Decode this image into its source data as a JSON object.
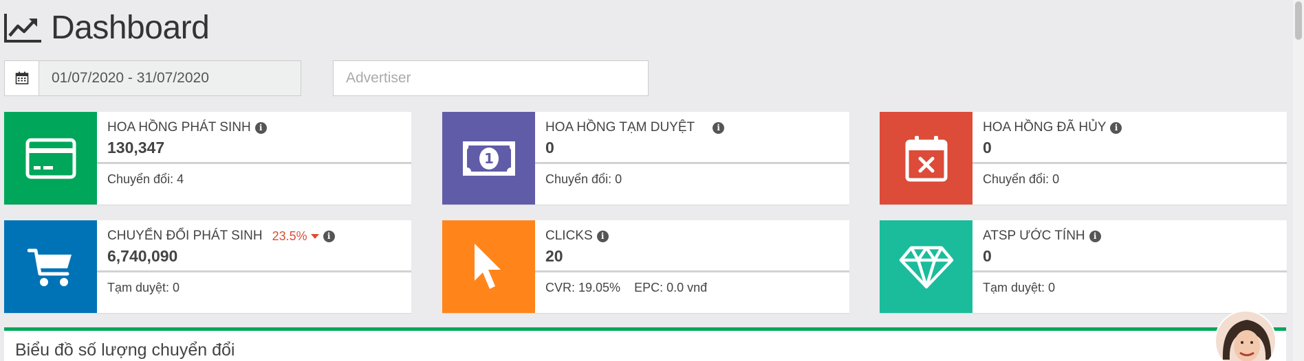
{
  "header": {
    "title": "Dashboard",
    "icon": "line-chart-icon"
  },
  "filters": {
    "date_range": "01/07/2020 - 31/07/2020",
    "advertiser_placeholder": "Advertiser"
  },
  "cards": [
    {
      "label": "HOA HỒNG PHÁT SINH",
      "value": "130,347",
      "footer": "Chuyển đổi: 4",
      "color": "#00a65a",
      "icon": "credit-card-icon"
    },
    {
      "label": "HOA HỒNG TẠM DUYỆT",
      "value": "0",
      "footer": "Chuyển đổi: 0",
      "color": "#605ca8",
      "icon": "money-bill-icon"
    },
    {
      "label": "HOA HỒNG ĐÃ HỦY",
      "value": "0",
      "footer": "Chuyển đổi: 0",
      "color": "#dd4b39",
      "icon": "calendar-cancel-icon"
    },
    {
      "label": "CHUYỂN ĐỔI PHÁT SINH",
      "trend": "23.5%",
      "value": "6,740,090",
      "footer": "Tạm duyệt: 0",
      "color": "#0073b7",
      "icon": "shopping-cart-icon"
    },
    {
      "label": "CLICKS",
      "value": "20",
      "footer_cvr": "CVR: 19.05%",
      "footer_epc": "EPC: 0.0 vnđ",
      "color": "#ff851b",
      "icon": "mouse-pointer-icon"
    },
    {
      "label": "ATSP ƯỚC TÍNH",
      "value": "0",
      "footer": "Tạm duyệt: 0",
      "color": "#1abc9c",
      "icon": "diamond-icon"
    }
  ],
  "chart_section": {
    "title": "Biểu đồ số lượng chuyển đổi",
    "accent": "#00a65a"
  }
}
